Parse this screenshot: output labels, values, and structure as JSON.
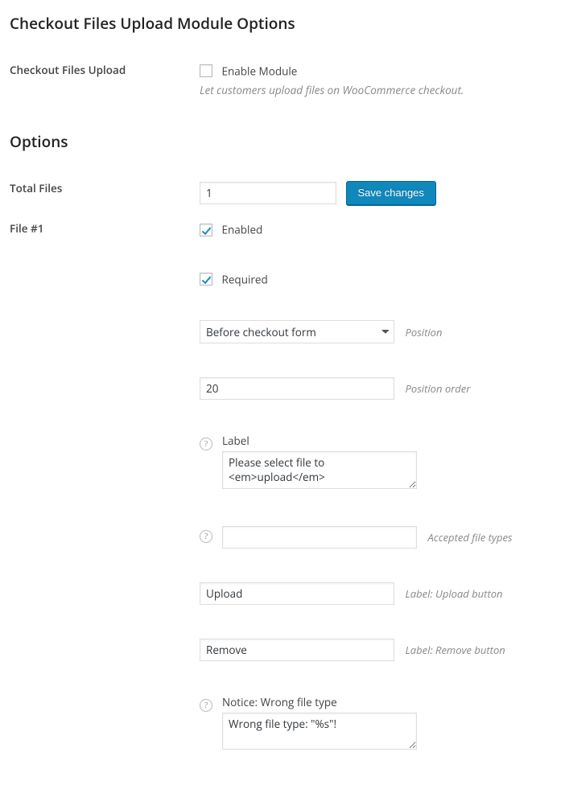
{
  "headings": {
    "module": "Checkout Files Upload Module Options",
    "options": "Options"
  },
  "module": {
    "row_label": "Checkout Files Upload",
    "enable_label": "Enable Module",
    "enable_checked": false,
    "description": "Let customers upload files on WooCommerce checkout."
  },
  "total_files": {
    "row_label": "Total Files",
    "value": "1",
    "save_button": "Save changes"
  },
  "file1": {
    "row_label": "File #1",
    "enabled": {
      "label": "Enabled",
      "checked": true
    },
    "required": {
      "label": "Required",
      "checked": true
    },
    "position": {
      "selected": "Before checkout form",
      "desc": "Position"
    },
    "position_order": {
      "value": "20",
      "desc": "Position order"
    },
    "label_field": {
      "top_label": "Label",
      "value": "Please select file to <em>upload</em>"
    },
    "accepted_types": {
      "value": "",
      "desc": "Accepted file types"
    },
    "upload_btn_label": {
      "value": "Upload",
      "desc": "Label: Upload button"
    },
    "remove_btn_label": {
      "value": "Remove",
      "desc": "Label: Remove button"
    },
    "notice_wrong_type": {
      "top_label": "Notice: Wrong file type",
      "value": "Wrong file type: \"%s\"!"
    }
  }
}
